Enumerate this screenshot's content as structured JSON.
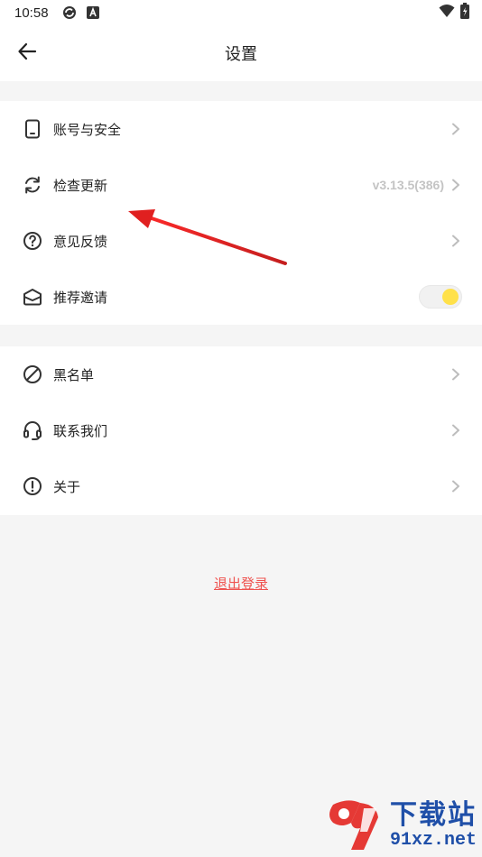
{
  "statusbar": {
    "time": "10:58",
    "icons": [
      "sync-status-icon",
      "a-badge-icon",
      "wifi-icon",
      "battery-icon"
    ]
  },
  "appbar": {
    "title": "设置",
    "back_icon": "arrow-left-icon"
  },
  "group1": [
    {
      "label": "账号与安全",
      "icon": "phone-icon"
    },
    {
      "label": "检查更新",
      "icon": "refresh-icon",
      "value": "v3.13.5(386)"
    },
    {
      "label": "意见反馈",
      "icon": "help-circle-icon"
    },
    {
      "label": "推荐邀请",
      "icon": "mail-icon",
      "toggle": true
    }
  ],
  "group2": [
    {
      "label": "黑名单",
      "icon": "block-icon"
    },
    {
      "label": "联系我们",
      "icon": "headset-icon"
    },
    {
      "label": "关于",
      "icon": "info-icon"
    }
  ],
  "logout": "退出登录",
  "watermark": {
    "big": "下载站",
    "small": "91xz.net"
  },
  "colors": {
    "accent_yellow": "#ffe14a",
    "logout_red": "#ef5350",
    "annotation_arrow": "#e02020",
    "watermark_blue": "#1f4fa8"
  }
}
